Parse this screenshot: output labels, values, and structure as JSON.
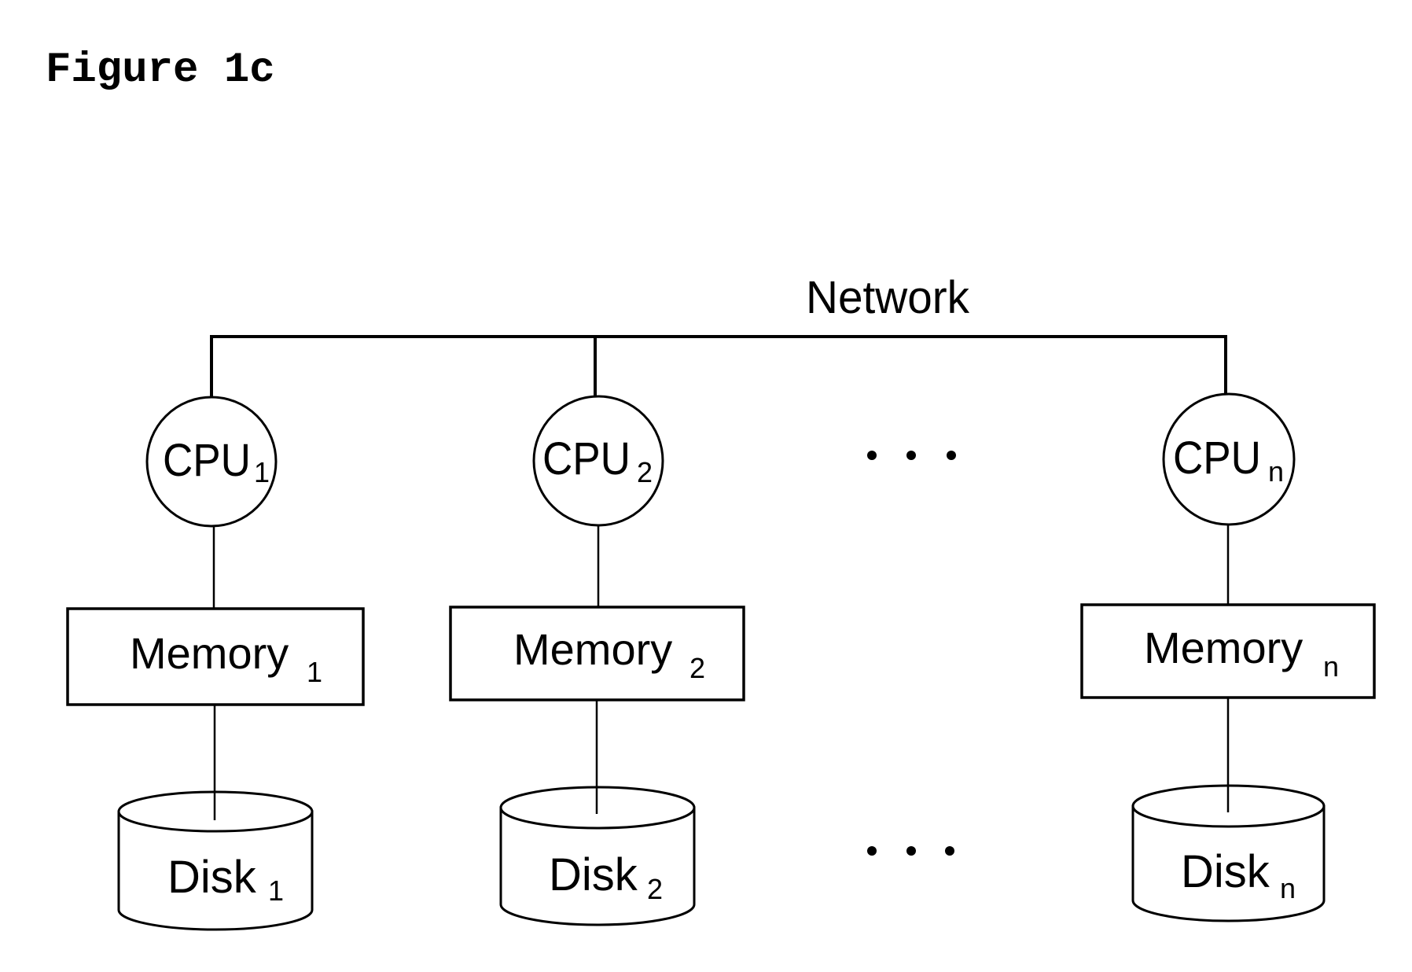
{
  "figure": {
    "title": "Figure 1c",
    "network_label": "Network"
  },
  "nodes": [
    {
      "cpu": "CPU",
      "cpu_sub": "1",
      "memory": "Memory",
      "memory_sub": "1",
      "disk": "Disk",
      "disk_sub": "1"
    },
    {
      "cpu": "CPU",
      "cpu_sub": "2",
      "memory": "Memory",
      "memory_sub": "2",
      "disk": "Disk",
      "disk_sub": "2"
    },
    {
      "cpu": "CPU",
      "cpu_sub": "n",
      "memory": "Memory",
      "memory_sub": "n",
      "disk": "Disk",
      "disk_sub": "n"
    }
  ],
  "ellipsis": {
    "cpu_row": "• • •",
    "disk_row": "• • •"
  },
  "colors": {
    "ink": "#000000",
    "background": "#ffffff"
  }
}
